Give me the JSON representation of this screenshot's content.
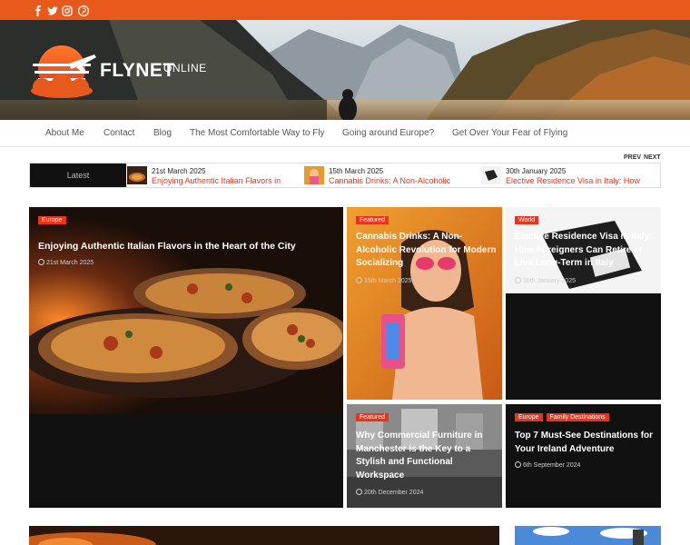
{
  "social": {
    "icons": [
      "facebook-icon",
      "twitter-icon",
      "instagram-icon",
      "pinterest-icon"
    ]
  },
  "brand": {
    "name": "FLYNET",
    "sub": "ONLINE",
    "accent": "#e85a1b",
    "red": "#e8341b"
  },
  "nav": {
    "items": [
      "About Me",
      "Contact",
      "Blog",
      "The Most Comfortable Way to Fly",
      "Going around Europe?",
      "Get Over Your Fear of Flying"
    ]
  },
  "ticker": {
    "prev": "PREV",
    "next": "NEXT",
    "label": "Latest",
    "items": [
      {
        "date": "21st March 2025",
        "title": "Enjoying Authentic Italian Flavors in"
      },
      {
        "date": "15th March 2025",
        "title": "Cannabis Drinks: A Non-Alcoholic"
      },
      {
        "date": "30th January 2025",
        "title": "Elective Residence Visa in Italy: How"
      }
    ]
  },
  "cards": [
    {
      "badges": [
        "Europe"
      ],
      "title": "Enjoying Authentic Italian Flavors in the Heart of the City",
      "date": "21st March 2025"
    },
    {
      "badges": [
        "Featured"
      ],
      "title": "Cannabis Drinks: A Non-Alcoholic Revolution for Modern Socializing",
      "date": "15th March 2025"
    },
    {
      "badges": [
        "World"
      ],
      "title": "Elective Residence Visa in Italy: How Foreigners Can Retire or Live Long-Term in Italy",
      "date": "30th January 2025"
    },
    {
      "badges": [
        "Featured"
      ],
      "title": "Why Commercial Furniture in Manchester is the Key to a Stylish and Functional Workspace",
      "date": "20th December 2024"
    },
    {
      "badges": [
        "Europe",
        "Family Destinations"
      ],
      "title": "Top 7 Must-See Destinations for Your Ireland Adventure",
      "date": "6th September 2024"
    }
  ]
}
